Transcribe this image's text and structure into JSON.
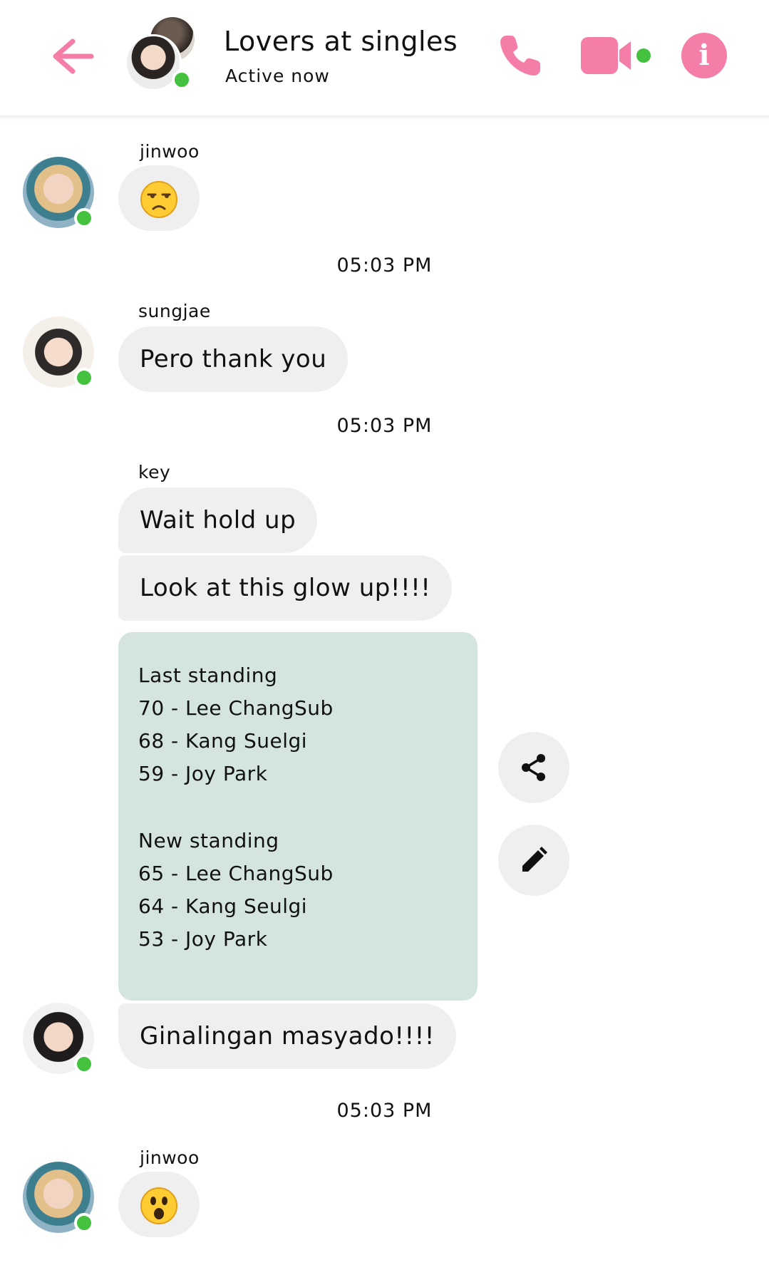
{
  "header": {
    "title": "Lovers at singles",
    "status": "Active now"
  },
  "colors": {
    "accent": "#f47ea8",
    "online": "#44c13e",
    "bubble": "#efefef",
    "card": "#d4e5df"
  },
  "messages": [
    {
      "sender": "jinwoo",
      "emoji": "unamused-face"
    },
    {
      "time": "05:03 PM"
    },
    {
      "sender": "sungjae",
      "text": "Pero thank you"
    },
    {
      "time": "05:03 PM"
    },
    {
      "sender": "key",
      "texts": [
        "Wait hold up",
        "Look at this glow up!!!!"
      ]
    },
    {
      "card": {
        "section1_title": "Last standing",
        "section1": [
          "70 - Lee ChangSub",
          "68 - Kang Suelgi",
          "59 - Joy Park"
        ],
        "section2_title": "New standing",
        "section2": [
          "65 - Lee ChangSub",
          "64 - Kang Seulgi",
          "53 - Joy Park"
        ]
      }
    },
    {
      "text": "Ginalingan masyado!!!!"
    },
    {
      "time": "05:03 PM"
    },
    {
      "sender": "jinwoo",
      "emoji": "astonished-face"
    }
  ],
  "icons": {
    "back": "arrow-left-icon",
    "call": "phone-icon",
    "video": "video-camera-icon",
    "info": "info-icon",
    "share": "share-icon",
    "edit": "pencil-icon"
  }
}
